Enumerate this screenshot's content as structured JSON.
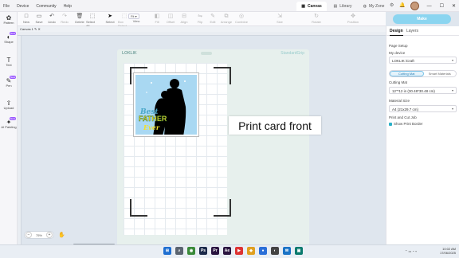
{
  "menu": [
    "File",
    "Device",
    "Community",
    "Help"
  ],
  "tabs": [
    {
      "label": "Canvas",
      "active": true
    },
    {
      "label": "Library",
      "active": false
    },
    {
      "label": "My Zone",
      "active": false
    }
  ],
  "window_controls": [
    "—",
    "☐",
    "✕"
  ],
  "left_tools": [
    {
      "label": "Pattern",
      "icon": "pattern-icon",
      "glyph": "✿",
      "badge": ""
    },
    {
      "label": "Shape",
      "icon": "shape-icon",
      "glyph": "◐",
      "badge": "New"
    },
    {
      "label": "Text",
      "icon": "text-icon",
      "glyph": "T",
      "badge": ""
    },
    {
      "label": "Pen",
      "icon": "pen-icon",
      "glyph": "✎",
      "badge": "New"
    },
    {
      "label": "Upload",
      "icon": "upload-icon",
      "glyph": "⇪",
      "badge": ""
    },
    {
      "label": "AI Painting",
      "icon": "ai-painting-icon",
      "glyph": "✦",
      "badge": "New"
    }
  ],
  "toolbar": {
    "items": [
      {
        "label": "New",
        "glyph": "□",
        "dim": false
      },
      {
        "label": "Save",
        "glyph": "▭",
        "dim": false
      },
      {
        "label": "Undo",
        "glyph": "↶",
        "dim": false
      },
      {
        "label": "Redo",
        "glyph": "↷",
        "dim": true
      },
      {
        "label": "Delete",
        "glyph": "🗑",
        "dim": false
      },
      {
        "label": "Select All",
        "glyph": "⬚",
        "dim": false
      },
      {
        "label": "Select",
        "glyph": "➤",
        "dim": false,
        "sel": true
      },
      {
        "label": "Box Select",
        "glyph": "⬚",
        "dim": true
      }
    ],
    "view_label": "View",
    "zoom_fit": "Fit",
    "right_items": [
      {
        "label": "Fill",
        "glyph": "◧"
      },
      {
        "label": "Offset",
        "glyph": "◫"
      },
      {
        "label": "Align",
        "glyph": "⊟"
      },
      {
        "label": "Flip",
        "glyph": "⇋"
      },
      {
        "label": "Edit",
        "glyph": "✎"
      },
      {
        "label": "Arrange",
        "glyph": "⧉"
      },
      {
        "label": "Combine",
        "glyph": "◎"
      },
      {
        "label": "Size",
        "glyph": "⇲"
      },
      {
        "label": "Rotate",
        "glyph": "↻"
      },
      {
        "label": "Position",
        "glyph": "✥"
      }
    ],
    "make_it": "Make"
  },
  "canvas_tab": "Canvas 1 ✎ ✕",
  "mat": {
    "brand_left": "LOKLIK",
    "brand_right": "StandardGrip"
  },
  "design": {
    "line1": "Best",
    "line2": "FATHER",
    "line3": "Ever"
  },
  "tooltip": "Print card front",
  "zoom": {
    "value": "75%",
    "minus": "−",
    "plus": "+"
  },
  "panel": {
    "tabs": [
      "Design",
      "Layers"
    ],
    "page_setup": "Page Setup",
    "my_device_label": "My device",
    "my_device_value": "LOKLIK iCraft",
    "seg": [
      "Cutting Mat",
      "Smart Materials"
    ],
    "cutting_mat_label": "Cutting Mat",
    "cutting_mat_value": "12\"*12 in (30.48*30.48 cm)",
    "material_size_label": "Material Size",
    "material_size_value": "A4 (21x29.7 cm)",
    "print_cut_label": "Print and Cut Job",
    "show_border": "Show Print Border"
  },
  "taskbar": {
    "apps": [
      {
        "glyph": "⊞",
        "color": "#1f6fd1",
        "icon": "windows-start-icon"
      },
      {
        "glyph": "⌕",
        "color": "#5a6470",
        "icon": "search-icon"
      },
      {
        "glyph": "◉",
        "color": "#3a8a3a",
        "icon": "chrome-icon"
      },
      {
        "glyph": "Ps",
        "color": "#1b2a4a",
        "icon": "photoshop-icon"
      },
      {
        "glyph": "Pr",
        "color": "#2a1540",
        "icon": "premiere-icon"
      },
      {
        "glyph": "Ae",
        "color": "#2a1540",
        "icon": "aftereffects-icon"
      },
      {
        "glyph": "▶",
        "color": "#d33",
        "icon": "media-icon"
      },
      {
        "glyph": "◆",
        "color": "#e0a020",
        "icon": "files-icon"
      },
      {
        "glyph": "●",
        "color": "#2b6fd8",
        "icon": "app-icon"
      },
      {
        "glyph": "◐",
        "color": "#444",
        "icon": "app2-icon"
      },
      {
        "glyph": "✉",
        "color": "#1a73c6",
        "icon": "mail-icon"
      },
      {
        "glyph": "▣",
        "color": "#0a7a6e",
        "icon": "loklik-icon"
      }
    ],
    "time": "10:02 AM",
    "date": "17/06/2025"
  }
}
